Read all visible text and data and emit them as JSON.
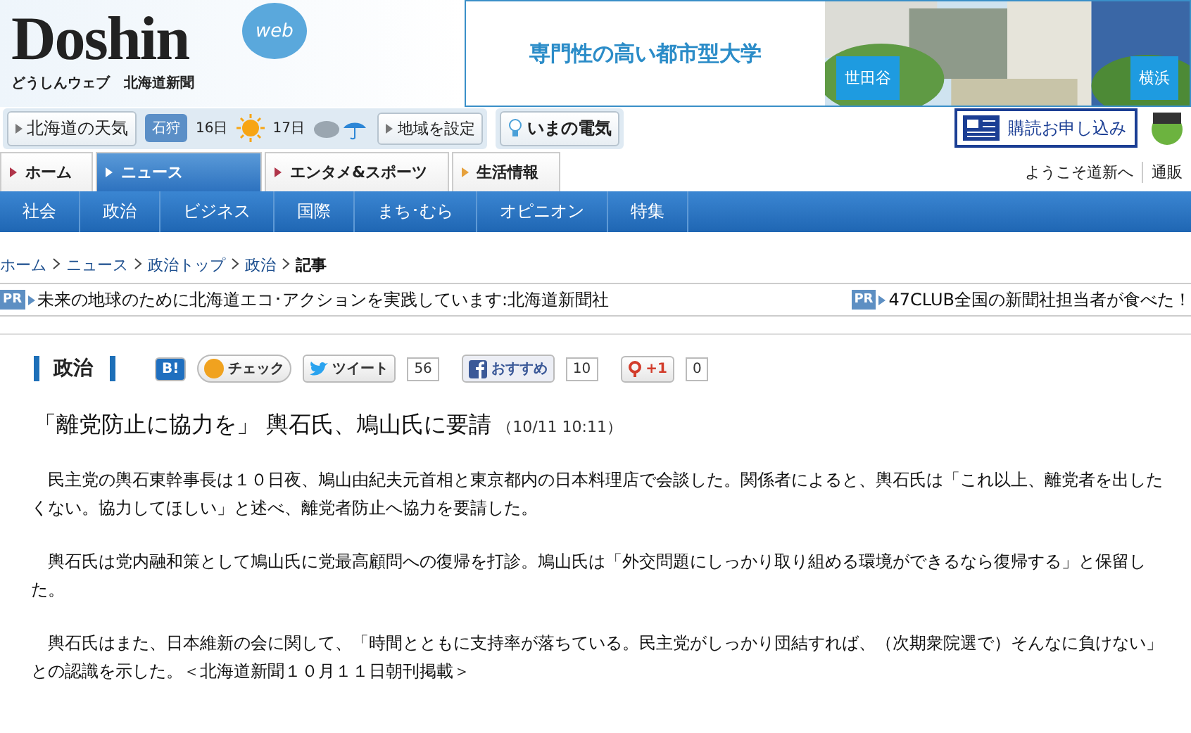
{
  "logo": {
    "title": "Doshin",
    "badge": "web",
    "subtitle": "どうしんウェブ　北海道新聞"
  },
  "ad": {
    "text": "専門性の高い都市型大学",
    "labels": [
      "世田谷",
      "横浜"
    ]
  },
  "weather": {
    "button": "北海道の天気",
    "region": "石狩",
    "days": [
      {
        "day": "16日",
        "kind": "sun"
      },
      {
        "day": "17日",
        "kind": "cloud_rain"
      }
    ],
    "set_region": "地域を設定",
    "power": "いまの電気"
  },
  "subscribe": "購読お申し込み",
  "tabs": [
    {
      "label": "ホーム",
      "selected": false
    },
    {
      "label": "ニュース",
      "selected": true
    },
    {
      "label": "エンタメ&スポーツ",
      "selected": false
    },
    {
      "label": "生活情報",
      "selected": false
    }
  ],
  "user_links": [
    "ようこそ道新へ",
    "通販"
  ],
  "categories": [
    "社会",
    "政治",
    "ビジネス",
    "国際",
    "まち･むら",
    "オピニオン",
    "特集"
  ],
  "breadcrumb": [
    "ホーム",
    "ニュース",
    "政治トップ",
    "政治",
    "記事"
  ],
  "pr": [
    {
      "badge": "PR",
      "text": "未来の地球のために北海道エコ･アクションを実践しています:北海道新聞社"
    },
    {
      "badge": "PR",
      "text": "47CLUB全国の新聞社担当者が食べた！"
    }
  ],
  "section": "政治",
  "social": [
    {
      "kind": "hatena",
      "label": "B!"
    },
    {
      "kind": "check",
      "label": "チェック"
    },
    {
      "kind": "tweet",
      "label": "ツイート",
      "count": "56"
    },
    {
      "kind": "facebook",
      "label": "おすすめ",
      "count": "10"
    },
    {
      "kind": "gplus",
      "label": "+1",
      "count": "0"
    }
  ],
  "article": {
    "headline": "「離党防止に協力を」 輿石氏、鳩山氏に要請",
    "time": "（10/11 10:11）",
    "paragraphs": [
      "民主党の輿石東幹事長は１０日夜、鳩山由紀夫元首相と東京都内の日本料理店で会談した。関係者によると、輿石氏は「これ以上、離党者を出したくない。協力してほしい」と述べ、離党者防止へ協力を要請した。",
      "輿石氏は党内融和策として鳩山氏に党最高顧問への復帰を打診。鳩山氏は「外交問題にしっかり取り組める環境ができるなら復帰する」と保留した。",
      "輿石氏はまた、日本維新の会に関して、「時間とともに支持率が落ちている。民主党がしっかり団結すれば、（次期衆院選で）そんなに負けない」との認識を示した。＜北海道新聞１０月１１日朝刊掲載＞"
    ]
  }
}
